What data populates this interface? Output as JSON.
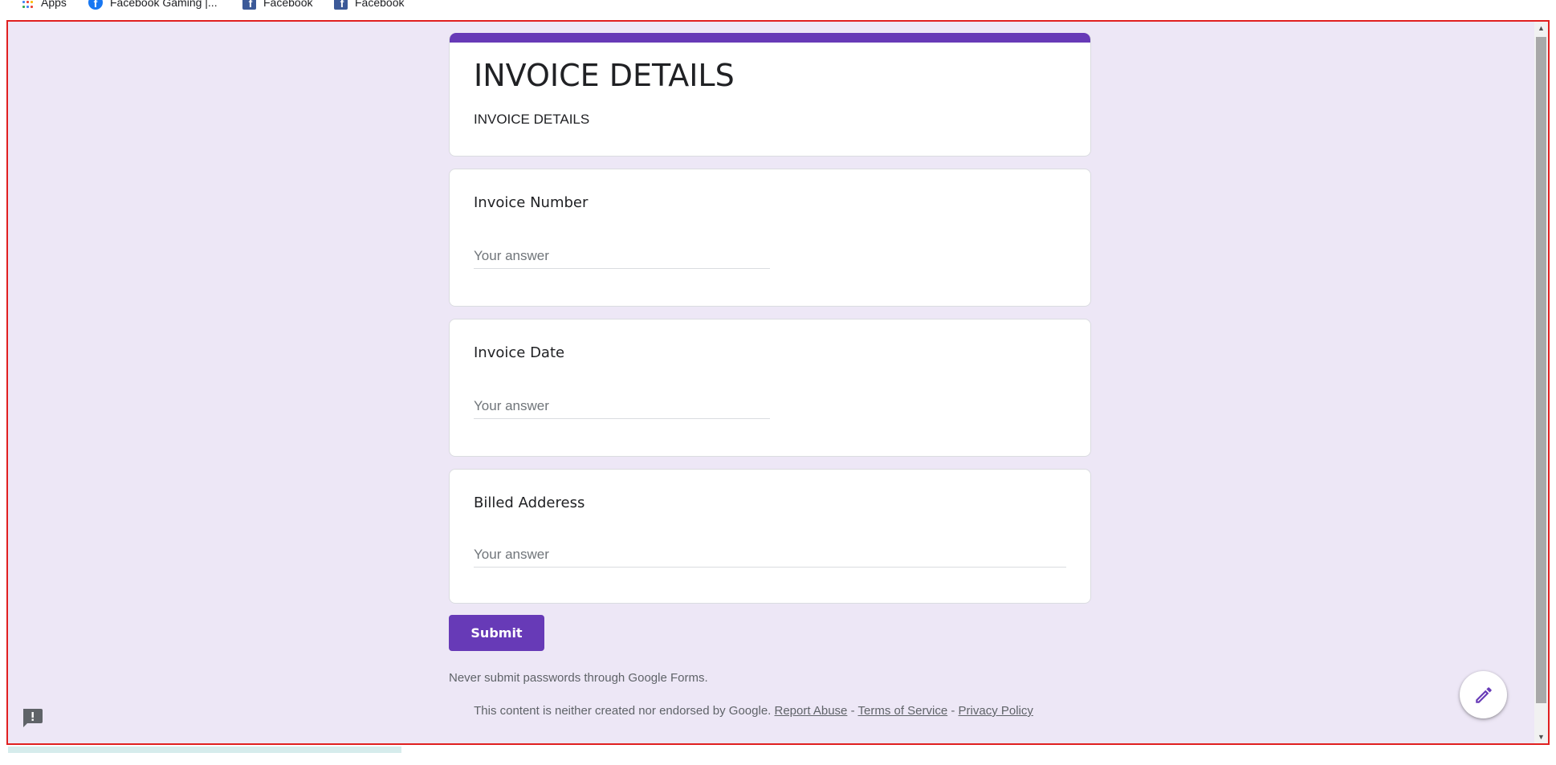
{
  "bookmarks": [
    {
      "label": "Apps",
      "icon": "apps-grid-icon"
    },
    {
      "label": "Facebook Gaming |...",
      "icon": "facebook-round-icon"
    },
    {
      "label": "Facebook",
      "icon": "facebook-square-icon"
    },
    {
      "label": "Facebook",
      "icon": "facebook-square-icon"
    }
  ],
  "form": {
    "title": "INVOICE DETAILS",
    "description": "INVOICE DETAILS",
    "accent_color": "#673ab7",
    "background_color": "#ede7f6",
    "questions": [
      {
        "label": "Invoice Number",
        "placeholder": "Your answer",
        "value": ""
      },
      {
        "label": "Invoice Date",
        "placeholder": "Your answer",
        "value": ""
      },
      {
        "label": "Billed Adderess",
        "placeholder": "Your answer",
        "value": ""
      }
    ],
    "submit_label": "Submit",
    "password_warning": "Never submit passwords through Google Forms."
  },
  "footer": {
    "disclaimer": "This content is neither created nor endorsed by Google.",
    "report_abuse": "Report Abuse",
    "separator": "-",
    "terms": "Terms of Service",
    "privacy": "Privacy Policy"
  },
  "icons": {
    "report": "report-issue-icon",
    "edit": "pencil-edit-icon"
  }
}
